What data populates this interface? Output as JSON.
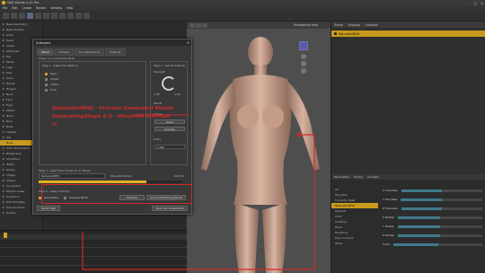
{
  "window": {
    "title": "DAZ Studio 4.12 Pro"
  },
  "menubar": {
    "items": [
      "File",
      "Edit",
      "Create",
      "Render",
      "Window",
      "Help"
    ]
  },
  "left_panel": {
    "rows": [
      {
        "label": "Base Geometry",
        "selected": false
      },
      {
        "label": "Base Morphs",
        "selected": false
      },
      {
        "label": "Actor",
        "selected": false
      },
      {
        "label": "Head",
        "selected": false
      },
      {
        "label": "Chest",
        "selected": false
      },
      {
        "label": "Abdomen",
        "selected": false
      },
      {
        "label": "Hip",
        "selected": false
      },
      {
        "label": "Pelvis",
        "selected": false
      },
      {
        "label": "Legs",
        "selected": false
      },
      {
        "label": "Feet",
        "selected": false
      },
      {
        "label": "Arms",
        "selected": false
      },
      {
        "label": "Hands",
        "selected": false
      },
      {
        "label": "Fingers",
        "selected": false
      },
      {
        "label": "Neck",
        "selected": false
      },
      {
        "label": "Face",
        "selected": false
      },
      {
        "label": "Eyes",
        "selected": false
      },
      {
        "label": "Mouth",
        "selected": false
      },
      {
        "label": "Nose",
        "selected": false
      },
      {
        "label": "Ears",
        "selected": false
      },
      {
        "label": "Brow",
        "selected": false
      },
      {
        "label": "Cheeks",
        "selected": false
      },
      {
        "label": "Jaw",
        "selected": false
      },
      {
        "label": "Body",
        "selected": true
      },
      {
        "label": "Torso Proportions",
        "selected": false
      },
      {
        "label": "Breast Size",
        "selected": false
      },
      {
        "label": "Shoulders",
        "selected": false
      },
      {
        "label": "Waist",
        "selected": false
      },
      {
        "label": "Glutes",
        "selected": false
      },
      {
        "label": "Thighs",
        "selected": false
      },
      {
        "label": "Calves",
        "selected": false
      },
      {
        "label": "Converted",
        "selected": false
      },
      {
        "label": "Morph Loader",
        "selected": false
      },
      {
        "label": "Projection",
        "selected": false
      },
      {
        "label": "Edit Template",
        "selected": false
      },
      {
        "label": "Pose Controls",
        "selected": false
      },
      {
        "label": "Hidden",
        "selected": false
      }
    ]
  },
  "viewport": {
    "camera_label": "Perspective View"
  },
  "scene_panel": {
    "tabs": [
      "Scene",
      "Shaping",
      "Surfaces"
    ],
    "selected_item": "NatureGirl8HD"
  },
  "bottom_right": {
    "tabs": [
      "Parameters",
      "Posing",
      "Animate"
    ],
    "list": [
      {
        "label": "All",
        "selected": false
      },
      {
        "label": "Favorites",
        "selected": false
      },
      {
        "label": "Currently Used",
        "selected": false
      },
      {
        "label": "NatureGirl8HD",
        "selected": true
      },
      {
        "label": "General",
        "selected": false
      },
      {
        "label": "Actor",
        "selected": false
      },
      {
        "label": "Clothing",
        "selected": false
      },
      {
        "label": "Head",
        "selected": false
      },
      {
        "label": "Morphing",
        "selected": false
      },
      {
        "label": "Pose Controls",
        "selected": false
      },
      {
        "label": "Other",
        "selected": false
      }
    ],
    "params": [
      {
        "label": "X Translate",
        "value": 0.5
      },
      {
        "label": "Y Translate",
        "value": 0.5
      },
      {
        "label": "Z Translate",
        "value": 0.5
      },
      {
        "label": "X Rotate",
        "value": 0.5
      },
      {
        "label": "Y Rotate",
        "value": 0.5
      },
      {
        "label": "Z Rotate",
        "value": 0.5
      },
      {
        "label": "Scale",
        "value": 0.5
      }
    ],
    "footer": "Show Sub Items"
  },
  "dialog": {
    "title": "X-Morphs",
    "tabs": [
      "Setup",
      "Presets",
      "Live Operations",
      "Settings"
    ],
    "description": "Shape your NatureGirl8HD",
    "step1": {
      "caption": "Step 1 - Select the Method",
      "options": [
        {
          "label": "Basic",
          "checked": true
        },
        {
          "label": "Shape",
          "checked": false
        },
        {
          "label": "Inflate",
          "checked": false
        },
        {
          "label": "Push",
          "checked": false
        }
      ]
    },
    "step2": {
      "caption": "Step 2 - Set Smoothing",
      "knob_label": "Strength",
      "knob_min": "0.00",
      "knob_max": "1.00",
      "falloff_label": "Falloff",
      "shape_label": "Shape",
      "btn_reset": "Reset",
      "btn_preview": "Preview",
      "scale_label": "Scale",
      "scale_value": "1.000"
    },
    "step3": {
      "caption": "Step 3 - Select the morph for X- Morph",
      "field": "NatureGirl8HD",
      "weight_label": "Strength Morph",
      "progress": 0.75,
      "pct": "100.0%"
    },
    "step4": {
      "caption": "Step 4 - Apply X-Morph",
      "opt_a": "Smoothing",
      "opt_b": "Preview Mode",
      "btn_preview": "Preview",
      "btn_apply": "Save X-Morphing Result"
    },
    "footer": {
      "left": "Quick Help",
      "right": "Open Documentation"
    }
  },
  "annotation": {
    "line1": "NatureGirl8HD - Preview Generated Morph",
    "line2": "GeneratingShape 0.0 - MorphHD X-Morph",
    "line3": "%"
  },
  "colors": {
    "accent": "#c89a1c",
    "annotation": "#d12a2a",
    "viewport_bg": "#4e4e4e",
    "cube": "#5b5ba8"
  }
}
